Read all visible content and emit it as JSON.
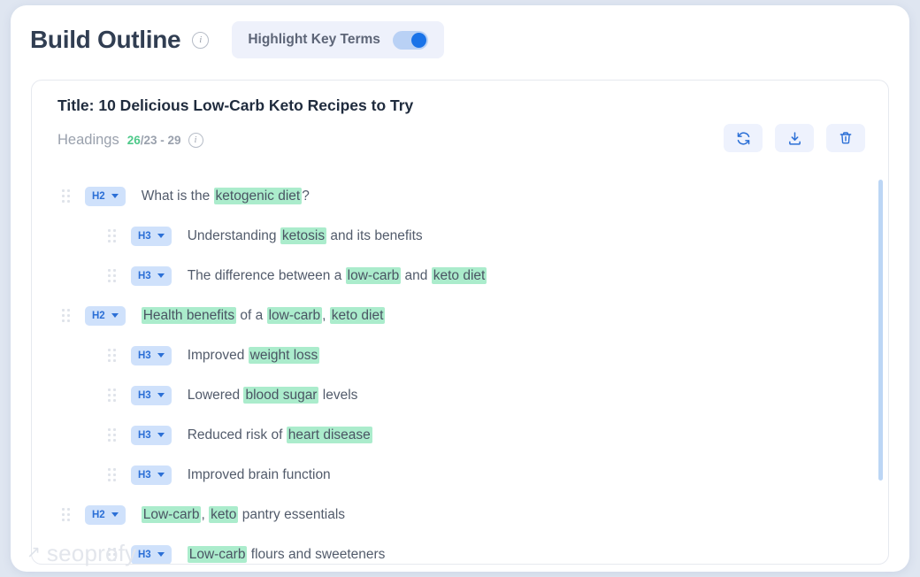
{
  "header": {
    "title": "Build Outline",
    "info_icon": "info-circle-icon",
    "toggle": {
      "label": "Highlight Key Terms",
      "state": "on",
      "accent": "#1a73e8"
    }
  },
  "card": {
    "title": "Title: 10 Delicious Low-Carb Keto Recipes to Try",
    "headings": {
      "label": "Headings",
      "current": "26",
      "range": "/23 - 29",
      "current_color": "#4ec98a",
      "info_icon": "info-circle-icon"
    },
    "actions": [
      {
        "name": "refresh-button",
        "icon": "refresh-icon"
      },
      {
        "name": "download-button",
        "icon": "download-icon"
      },
      {
        "name": "delete-button",
        "icon": "trash-icon"
      }
    ],
    "rows": [
      {
        "level": "H2",
        "parts": [
          {
            "t": "What is the ",
            "hl": false
          },
          {
            "t": "ketogenic diet",
            "hl": true
          },
          {
            "t": "?",
            "hl": false
          }
        ]
      },
      {
        "level": "H3",
        "parts": [
          {
            "t": "Understanding ",
            "hl": false
          },
          {
            "t": "ketosis",
            "hl": true
          },
          {
            "t": " and its benefits",
            "hl": false
          }
        ]
      },
      {
        "level": "H3",
        "parts": [
          {
            "t": "The difference between a ",
            "hl": false
          },
          {
            "t": "low-carb",
            "hl": true
          },
          {
            "t": " and ",
            "hl": false
          },
          {
            "t": "keto diet",
            "hl": true
          }
        ]
      },
      {
        "level": "H2",
        "parts": [
          {
            "t": "Health benefits",
            "hl": true
          },
          {
            "t": " of a ",
            "hl": false
          },
          {
            "t": "low-carb",
            "hl": true
          },
          {
            "t": ", ",
            "hl": false
          },
          {
            "t": "keto diet",
            "hl": true
          }
        ]
      },
      {
        "level": "H3",
        "parts": [
          {
            "t": "Improved ",
            "hl": false
          },
          {
            "t": "weight loss",
            "hl": true
          }
        ]
      },
      {
        "level": "H3",
        "parts": [
          {
            "t": "Lowered ",
            "hl": false
          },
          {
            "t": "blood sugar",
            "hl": true
          },
          {
            "t": " levels",
            "hl": false
          }
        ]
      },
      {
        "level": "H3",
        "parts": [
          {
            "t": "Reduced risk of ",
            "hl": false
          },
          {
            "t": "heart disease",
            "hl": true
          }
        ]
      },
      {
        "level": "H3",
        "parts": [
          {
            "t": "Improved brain function",
            "hl": false
          }
        ]
      },
      {
        "level": "H2",
        "parts": [
          {
            "t": "Low-carb",
            "hl": true
          },
          {
            "t": ", ",
            "hl": false
          },
          {
            "t": "keto",
            "hl": true
          },
          {
            "t": " pantry essentials",
            "hl": false
          }
        ]
      },
      {
        "level": "H3",
        "parts": [
          {
            "t": "Low-carb",
            "hl": true
          },
          {
            "t": " flours and sweeteners",
            "hl": false
          }
        ]
      }
    ],
    "highlight_color": "#abeccc",
    "badge_bg": "#cfe1fb",
    "badge_fg": "#2b6fd6"
  },
  "scrollbar": {
    "name": "vertical-scrollbar"
  },
  "watermark": {
    "arrow": "↗",
    "text": "seoprofy"
  }
}
